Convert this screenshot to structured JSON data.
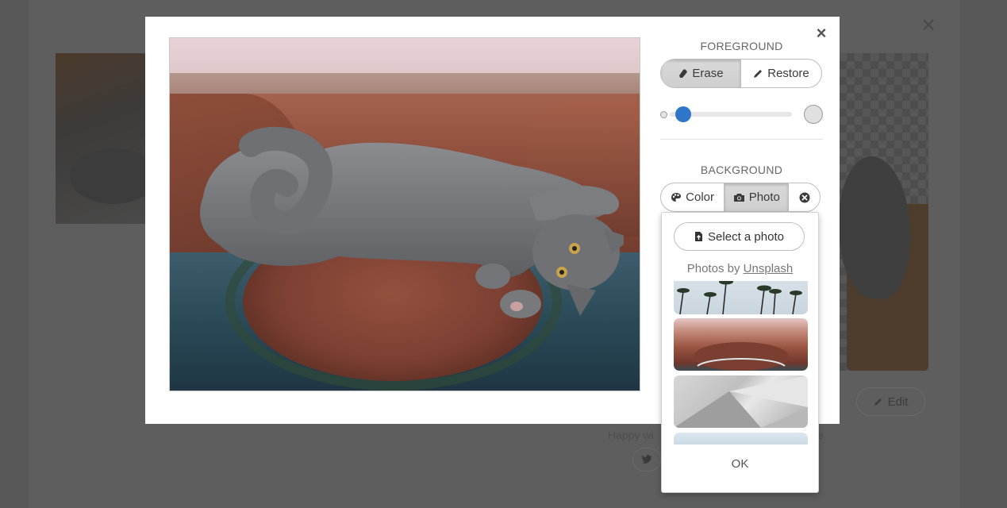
{
  "background_page": {
    "edit_label": "Edit",
    "happy_text": "Happy wi",
    "happy_text_tail": "e"
  },
  "modal": {
    "close_glyph": "×",
    "foreground": {
      "title": "FOREGROUND",
      "erase_label": "Erase",
      "restore_label": "Restore",
      "active_tool": "Erase",
      "brush_size_fraction": 0.05
    },
    "background": {
      "title": "BACKGROUND",
      "color_label": "Color",
      "photo_label": "Photo",
      "active_tab": "Photo"
    },
    "photo_dropdown": {
      "select_label": "Select a photo",
      "photos_by_prefix": "Photos by ",
      "photos_by_link": "Unsplash",
      "ok_label": "OK",
      "thumbnails": [
        "palm-trees-photo",
        "canyon-photo",
        "abstract-gray-photo",
        "sky-photo"
      ]
    }
  },
  "colors": {
    "accent": "#2f76c8",
    "overlay": "#585858"
  }
}
